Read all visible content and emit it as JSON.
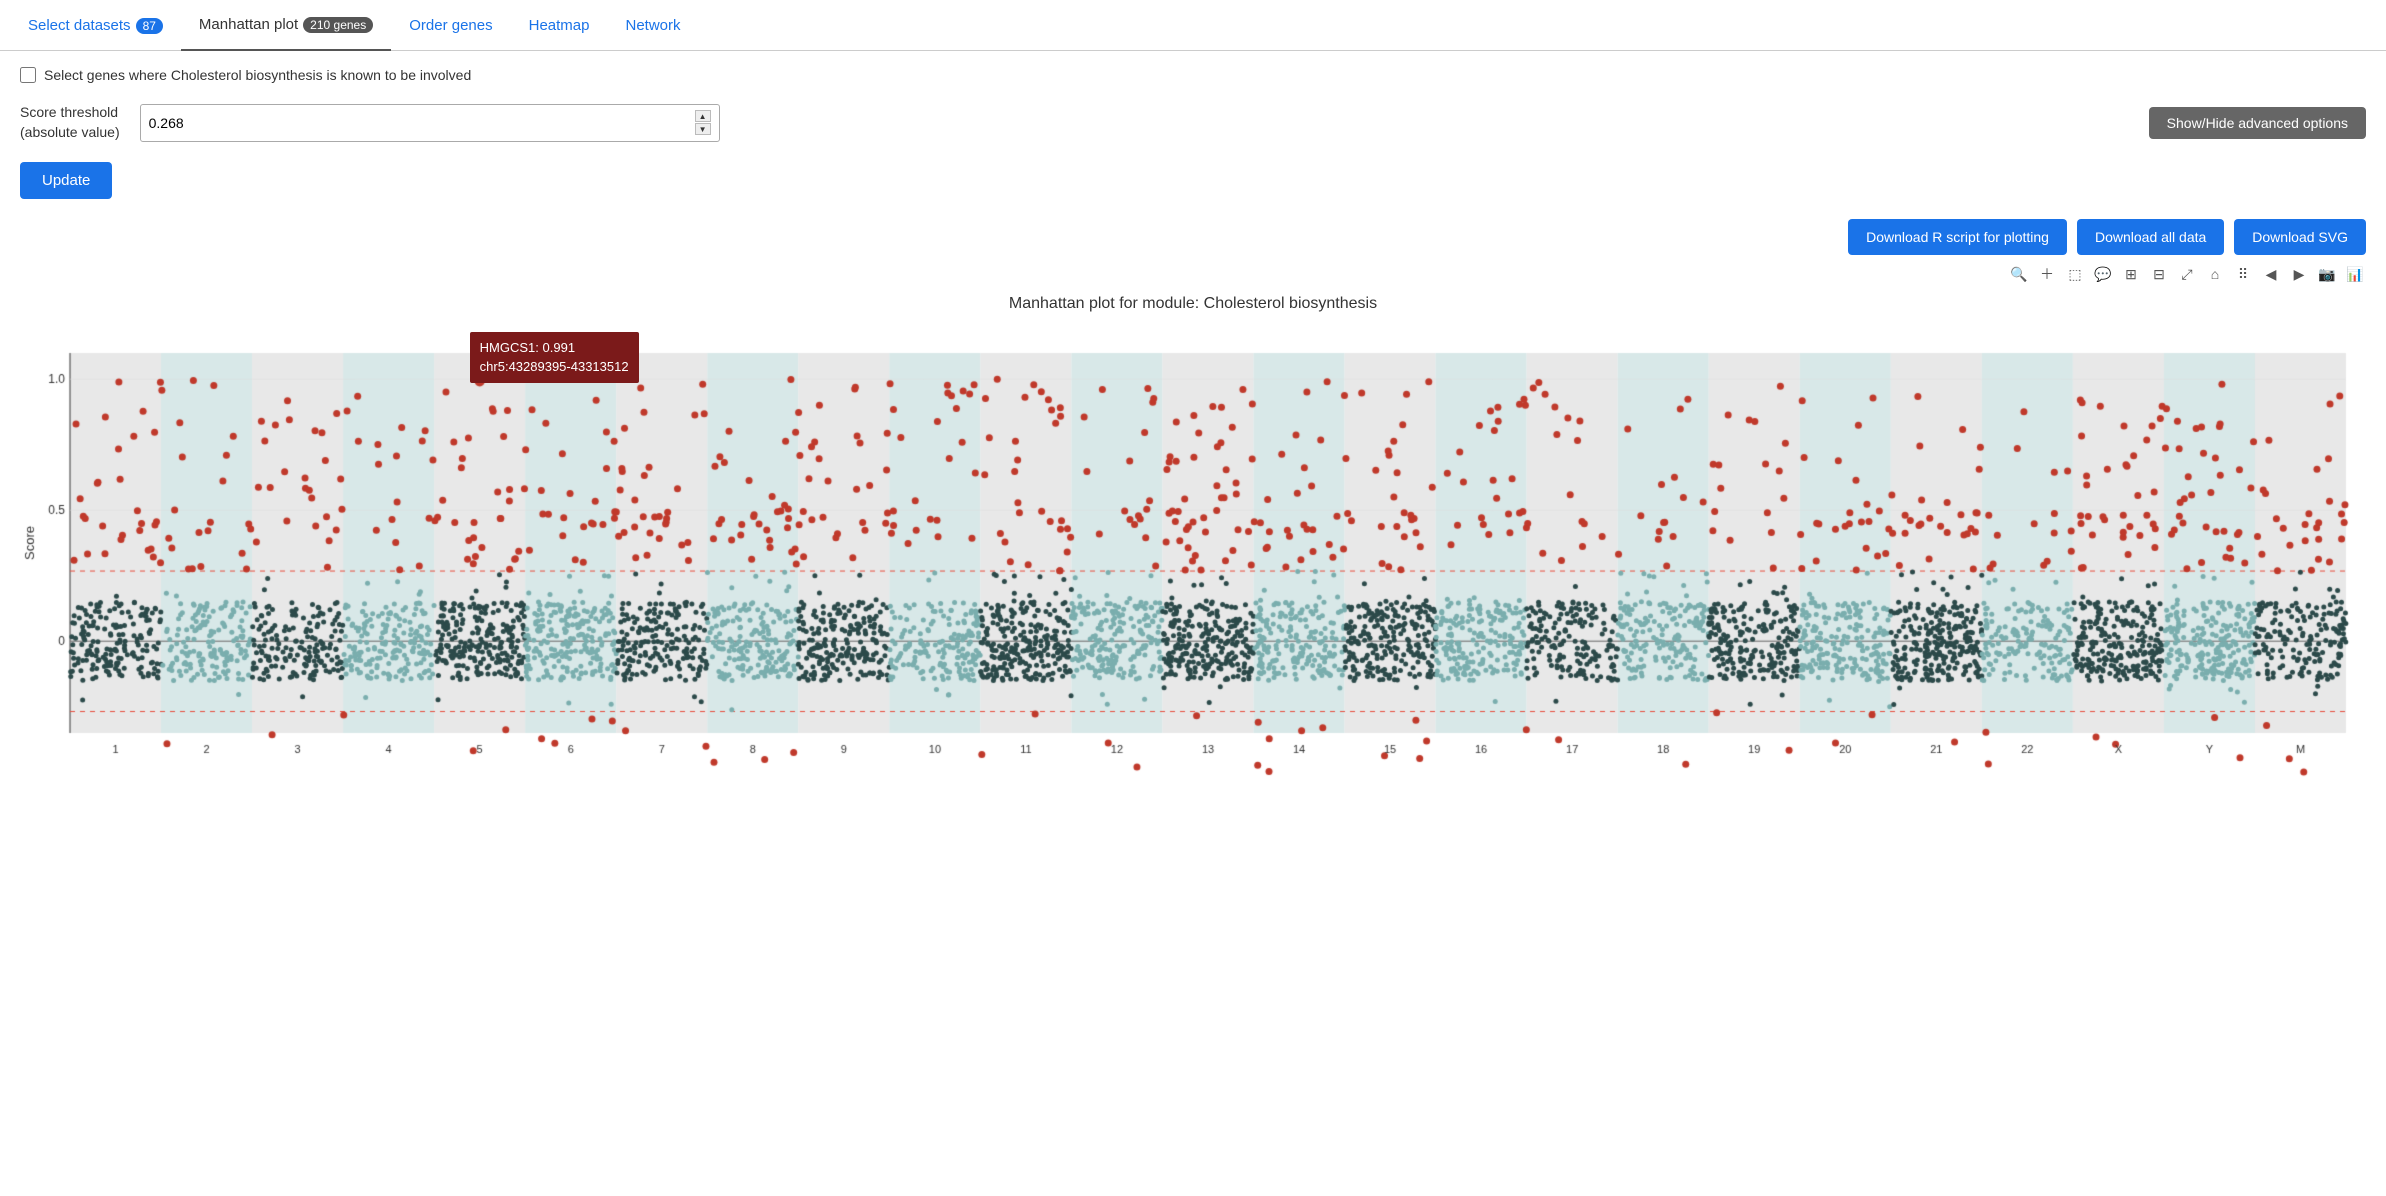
{
  "tabs": [
    {
      "id": "select-datasets",
      "label": "Select datasets",
      "badge": "87",
      "active": false
    },
    {
      "id": "manhattan-plot",
      "label": "Manhattan plot",
      "badge": "210 genes",
      "active": true
    },
    {
      "id": "order-genes",
      "label": "Order genes",
      "badge": null,
      "active": false
    },
    {
      "id": "heatmap",
      "label": "Heatmap",
      "badge": null,
      "active": false
    },
    {
      "id": "network",
      "label": "Network",
      "badge": null,
      "active": false
    }
  ],
  "checkbox": {
    "label": "Select genes where Cholesterol biosynthesis is known to be involved"
  },
  "score_threshold": {
    "label_line1": "Score threshold",
    "label_line2": "(absolute value)",
    "value": "0.268"
  },
  "buttons": {
    "advanced": "Show/Hide advanced options",
    "update": "Update",
    "download_r": "Download R script for plotting",
    "download_all": "Download all data",
    "download_svg": "Download SVG"
  },
  "chart": {
    "title": "Manhattan plot for module: Cholesterol biosynthesis",
    "y_axis_label": "Score",
    "x_axis_label": "",
    "chromosomes": [
      "1",
      "2",
      "3",
      "4",
      "5",
      "6",
      "7",
      "8",
      "9",
      "10",
      "11",
      "12",
      "13",
      "14",
      "15",
      "16",
      "17",
      "18",
      "19",
      "20",
      "21",
      "22",
      "X",
      "Y",
      "M"
    ],
    "threshold": 0.268,
    "tooltip": {
      "gene": "HMGCS1: 0.991",
      "location": "chr5:43289395-43313512"
    }
  },
  "toolbar_icons": [
    "zoom",
    "plus",
    "select-box",
    "speech-bubble",
    "plus-square",
    "minus-square",
    "arrows",
    "home",
    "dots-grid",
    "arrow-left",
    "arrow-right",
    "camera",
    "bar-chart"
  ],
  "colors": {
    "tab_active_text": "#333333",
    "tab_inactive_text": "#1a73e8",
    "badge_blue": "#1a73e8",
    "btn_blue": "#1a73e8",
    "btn_gray": "#666666",
    "dot_dark": "#3a4a4a",
    "dot_light": "#8aaeae",
    "dot_red": "#c0392b",
    "threshold_line": "#e74c3c",
    "tooltip_bg": "#7b1a1a"
  }
}
